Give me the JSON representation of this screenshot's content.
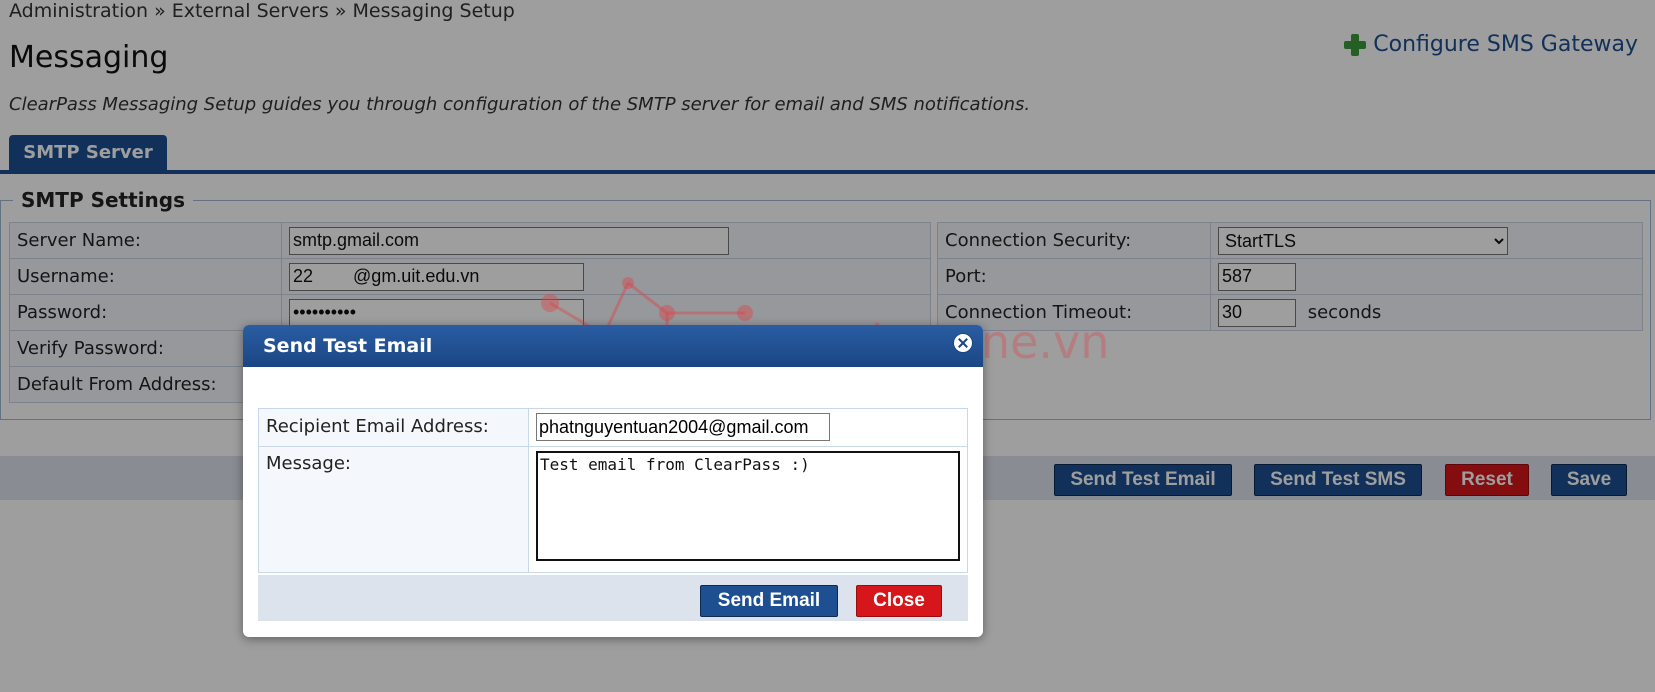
{
  "breadcrumb": "Administration » External Servers » Messaging Setup",
  "page_title": "Messaging",
  "sms_gateway_link": "Configure SMS Gateway",
  "subtitle": "ClearPass Messaging Setup guides you through configuration of the SMTP server for email and SMS notifications.",
  "tab": "SMTP Server",
  "smtp": {
    "legend": "SMTP Settings",
    "server_name_label": "Server Name:",
    "server_name_value": "smtp.gmail.com",
    "username_label": "Username:",
    "username_value": "22        @gm.uit.edu.vn",
    "password_label": "Password:",
    "password_value": "••••••••••",
    "verify_password_label": "Verify Password:",
    "default_from_label": "Default From Address:",
    "connection_security_label": "Connection Security:",
    "connection_security_value": "StartTLS",
    "port_label": "Port:",
    "port_value": "587",
    "timeout_label": "Connection Timeout:",
    "timeout_value": "30",
    "timeout_unit": "seconds"
  },
  "buttons": {
    "send_test_email": "Send Test Email",
    "send_test_sms": "Send Test SMS",
    "reset": "Reset",
    "save": "Save"
  },
  "watermark": "securityzone.vn",
  "dialog": {
    "title": "Send Test Email",
    "recipient_label": "Recipient Email Address:",
    "recipient_value": "phatnguyentuan2004@gmail.com",
    "message_label": "Message:",
    "message_value": "Test email from ClearPass :)",
    "send_email": "Send Email",
    "close": "Close"
  },
  "colors": {
    "brand_blue": "#1d4f91",
    "danger_red": "#d6161a",
    "link_blue": "#1d4f91"
  },
  "icons": [
    "plus-icon",
    "close-icon",
    "chevron-down-icon"
  ]
}
